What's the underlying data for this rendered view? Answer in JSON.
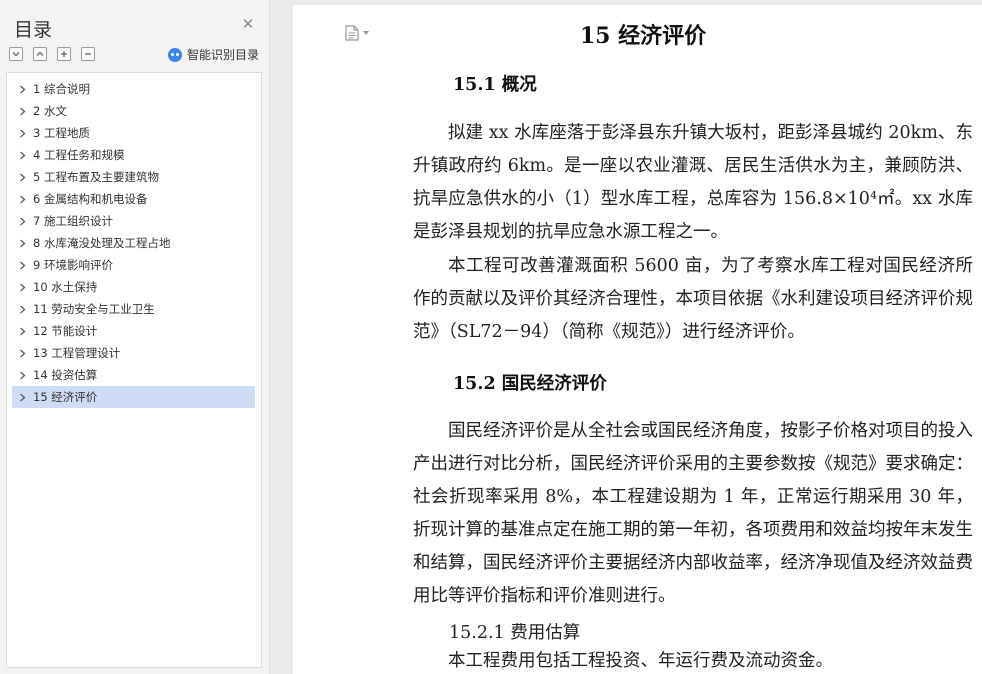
{
  "outline": {
    "title": "目录",
    "smart_label": "智能识别目录",
    "items": [
      {
        "label": "1 综合说明"
      },
      {
        "label": "2 水文"
      },
      {
        "label": "3 工程地质"
      },
      {
        "label": "4 工程任务和规模"
      },
      {
        "label": "5 工程布置及主要建筑物"
      },
      {
        "label": "6 金属结构和机电设备"
      },
      {
        "label": "7 施工组织设计"
      },
      {
        "label": "8 水库淹没处理及工程占地"
      },
      {
        "label": "9 环境影响评价"
      },
      {
        "label": "10 水土保持"
      },
      {
        "label": "11 劳动安全与工业卫生"
      },
      {
        "label": "12 节能设计"
      },
      {
        "label": "13 工程管理设计"
      },
      {
        "label": "14 投资估算"
      },
      {
        "label": "15 经济评价"
      }
    ],
    "selected_index": 14
  },
  "document": {
    "title": "15 经济评价",
    "s1_heading": "15.1 概况",
    "s1_p1": "拟建 xx 水库座落于彭泽县东升镇大坂村，距彭泽县城约 20km、东升镇政府约 6km。是一座以农业灌溉、居民生活供水为主，兼顾防洪、抗旱应急供水的小（1）型水库工程，总库容为 156.8×10⁴㎡。xx 水库是彭泽县规划的抗旱应急水源工程之一。",
    "s1_p2": "本工程可改善灌溉面积 5600 亩，为了考察水库工程对国民经济所作的贡献以及评价其经济合理性，本项目依据《水利建设项目经济评价规范》（SL72－94）（简称《规范》）进行经济评价。",
    "s2_heading": "15.2 国民经济评价",
    "s2_p1": "国民经济评价是从全社会或国民经济角度，按影子价格对项目的投入产出进行对比分析，国民经济评价采用的主要参数按《规范》要求确定：社会折现率采用 8%，本工程建设期为 1 年，正常运行期采用 30 年，折现计算的基准点定在施工期的第一年初，各项费用和效益均按年末发生和结算，国民经济评价主要据经济内部收益率，经济净现值及经济效益费用比等评价指标和评价准则进行。",
    "s21_heading": "15.2.1 费用估算",
    "s21_p1": "本工程费用包括工程投资、年运行费及流动资金。"
  }
}
